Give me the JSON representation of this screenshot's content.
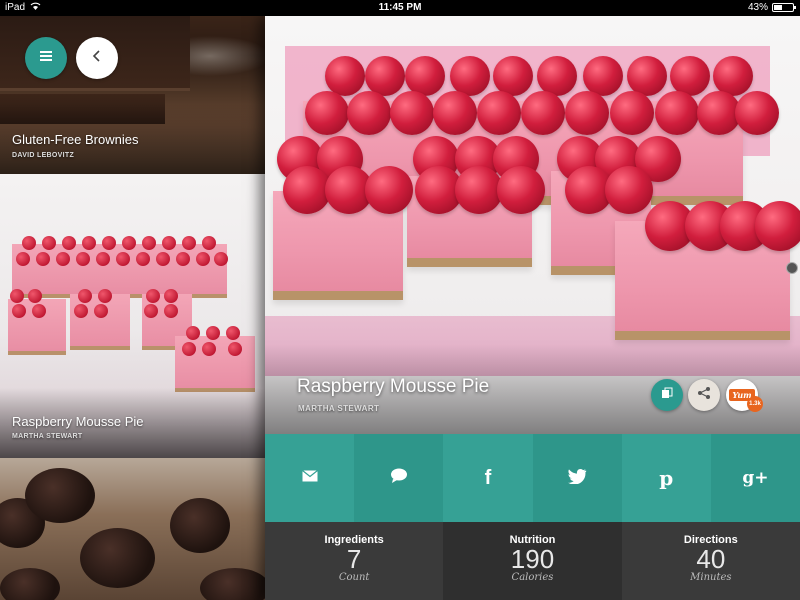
{
  "status_bar": {
    "carrier": "iPad",
    "time": "11:45 PM",
    "battery_text": "43%",
    "battery_level": 0.43
  },
  "nav": {
    "menu_icon": "hamburger-icon",
    "back_icon": "chevron-left-icon"
  },
  "recipe_list": [
    {
      "title": "Gluten-Free Brownies",
      "author": "DAVID LEBOVITZ"
    },
    {
      "title": "Raspberry Mousse Pie",
      "author": "MARTHA STEWART"
    },
    {
      "title": "",
      "author": ""
    }
  ],
  "detail": {
    "title": "Raspberry Mousse Pie",
    "author": "MARTHA STEWART",
    "yum_label": "Yum",
    "yum_count": "1.3k"
  },
  "share_buttons": [
    {
      "icon": "email-icon"
    },
    {
      "icon": "message-icon"
    },
    {
      "icon": "facebook-icon",
      "glyph": "f"
    },
    {
      "icon": "twitter-icon"
    },
    {
      "icon": "pinterest-icon",
      "glyph": "p"
    },
    {
      "icon": "google-plus-icon",
      "glyph": "g+"
    }
  ],
  "stats": [
    {
      "label": "Ingredients",
      "value": "7",
      "unit": "Count"
    },
    {
      "label": "Nutrition",
      "value": "190",
      "unit": "Calories"
    },
    {
      "label": "Directions",
      "value": "40",
      "unit": "Minutes"
    }
  ],
  "colors": {
    "teal": "#36a195",
    "teal_dark": "#2b9a8f",
    "stats_bg": "#3a3a3a",
    "yum_orange": "#e8651f"
  }
}
